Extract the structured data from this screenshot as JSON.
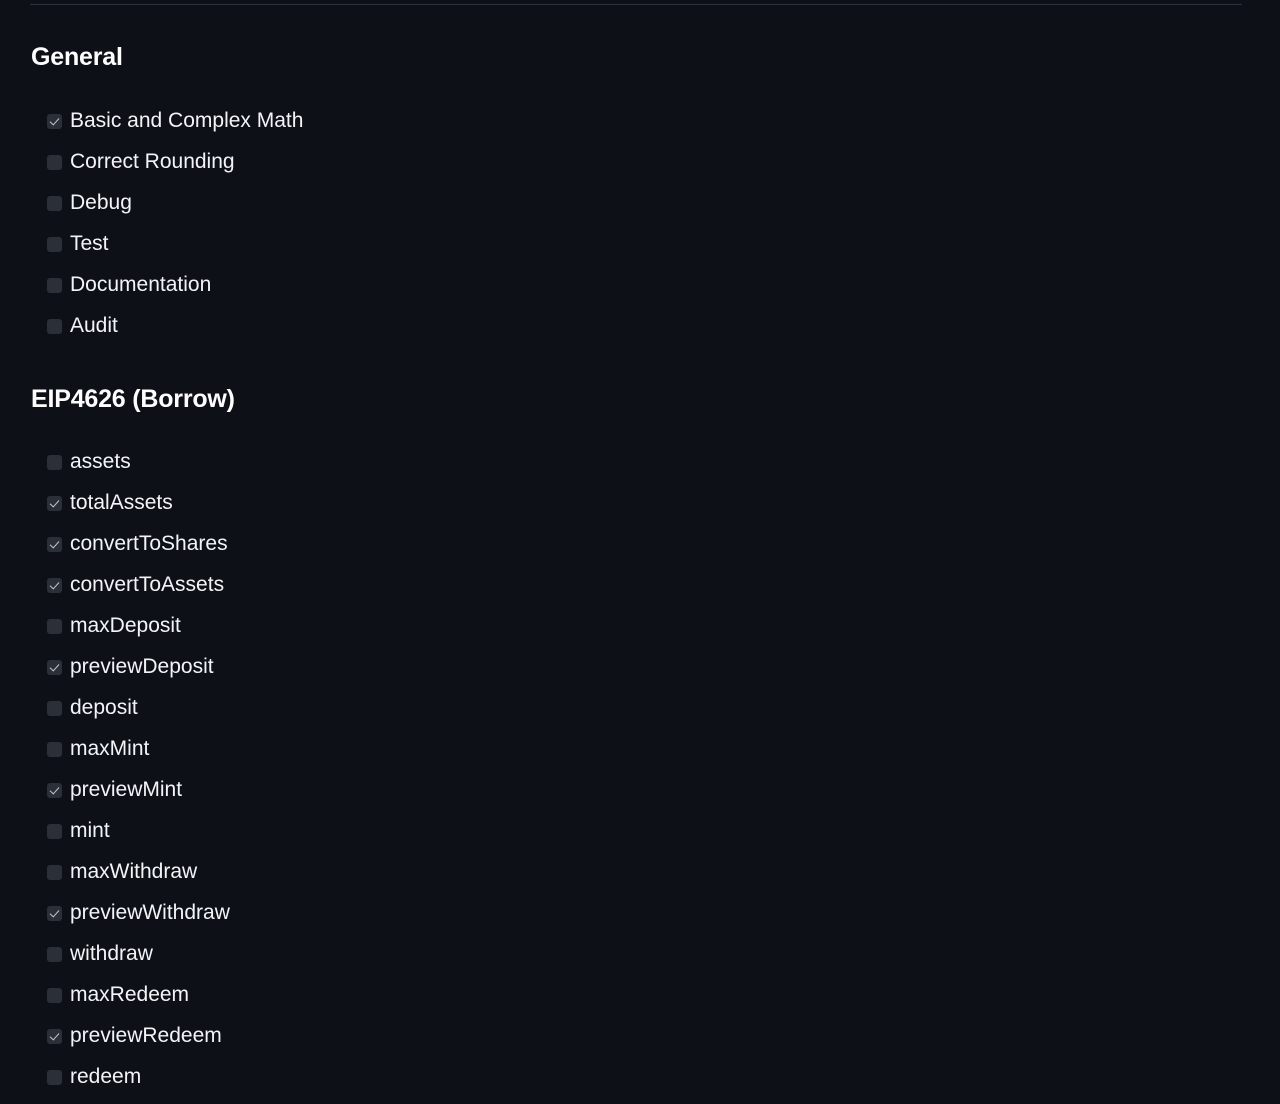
{
  "theme": {
    "background": "#0d1117",
    "divider": "#2d333d",
    "text": "#f2f4f7",
    "heading": "#ffffff",
    "checkbox_fill": "#2b2f37",
    "checkmark": "#c2c7cf"
  },
  "sections": [
    {
      "id": "general",
      "heading": "General",
      "options": [
        {
          "label": "Basic and Complex Math",
          "checked": true
        },
        {
          "label": "Correct Rounding",
          "checked": false
        },
        {
          "label": "Debug",
          "checked": false
        },
        {
          "label": "Test",
          "checked": false
        },
        {
          "label": "Documentation",
          "checked": false
        },
        {
          "label": "Audit",
          "checked": false
        }
      ]
    },
    {
      "id": "eip4626",
      "heading": "EIP4626 (Borrow)",
      "options": [
        {
          "label": "assets",
          "checked": false
        },
        {
          "label": "totalAssets",
          "checked": true
        },
        {
          "label": "convertToShares",
          "checked": true
        },
        {
          "label": "convertToAssets",
          "checked": true
        },
        {
          "label": "maxDeposit",
          "checked": false
        },
        {
          "label": "previewDeposit",
          "checked": true
        },
        {
          "label": "deposit",
          "checked": false
        },
        {
          "label": "maxMint",
          "checked": false
        },
        {
          "label": "previewMint",
          "checked": true
        },
        {
          "label": "mint",
          "checked": false
        },
        {
          "label": "maxWithdraw",
          "checked": false
        },
        {
          "label": "previewWithdraw",
          "checked": true
        },
        {
          "label": "withdraw",
          "checked": false
        },
        {
          "label": "maxRedeem",
          "checked": false
        },
        {
          "label": "previewRedeem",
          "checked": true
        },
        {
          "label": "redeem",
          "checked": false
        }
      ]
    }
  ]
}
